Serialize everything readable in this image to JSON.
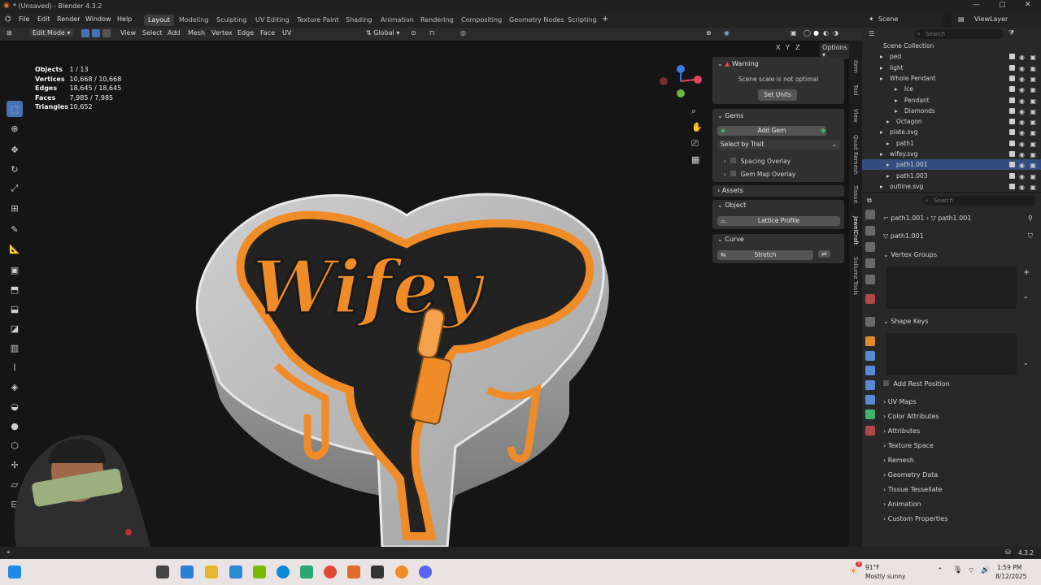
{
  "window": {
    "title": "* (Unsaved) - Blender 4.3.2",
    "version": "4.3.2"
  },
  "menu": {
    "items": [
      "File",
      "Edit",
      "Render",
      "Window",
      "Help"
    ]
  },
  "workspaces": [
    "Layout",
    "Modeling",
    "Sculpting",
    "UV Editing",
    "Texture Paint",
    "Shading",
    "Animation",
    "Rendering",
    "Compositing",
    "Geometry Nodes",
    "Scripting"
  ],
  "active_workspace": "Layout",
  "scene": {
    "name": "Scene",
    "view_layer": "ViewLayer"
  },
  "viewport_header": {
    "mode": "Edit Mode",
    "menus": [
      "View",
      "Select",
      "Add",
      "Mesh",
      "Vertex",
      "Edge",
      "Face",
      "UV"
    ],
    "transform": "Global",
    "options": "Options",
    "axes": [
      "X",
      "Y",
      "Z"
    ]
  },
  "stats": [
    {
      "label": "Objects",
      "value": "1 / 13"
    },
    {
      "label": "Vertices",
      "value": "10,668 / 10,668"
    },
    {
      "label": "Edges",
      "value": "18,645 / 18,645"
    },
    {
      "label": "Faces",
      "value": "7,985 / 7,985"
    },
    {
      "label": "Triangles",
      "value": "10,652"
    }
  ],
  "npanel": {
    "warning_title": "Warning",
    "warning_text": "Scene scale is not optimal",
    "set_units": "Set Units",
    "gems_title": "Gems",
    "add_gem": "Add Gem",
    "select_by_trait": "Select by Trait",
    "spacing_overlay": "Spacing Overlay",
    "gem_map_overlay": "Gem Map Overlay",
    "assets": "Assets",
    "object_title": "Object",
    "lattice_profile": "Lattice Profile",
    "curve_title": "Curve",
    "stretch": "Stretch",
    "tabs": [
      "Item",
      "Tool",
      "View",
      "Quad Remesh",
      "Tissue",
      "JewelCraft",
      "Sollumz Tools"
    ]
  },
  "outliner": {
    "search_placeholder": "Search",
    "rows": [
      "Scene Collection",
      "ped",
      "light",
      "Whole Pendant",
      "Ice",
      "Pendant",
      "Diamonds",
      "Octagon",
      "plate.svg",
      "path1",
      "wifey.svg",
      "path1.001",
      "path1.003",
      "outline.svg",
      "path1.002"
    ]
  },
  "properties": {
    "search_placeholder": "Search",
    "breadcrumb_obj": "path1.001",
    "breadcrumb_data": "path1.001",
    "data_name": "path1.001",
    "vertex_groups": "Vertex Groups",
    "shape_keys": "Shape Keys",
    "add_rest_position": "Add Rest Position",
    "sections": [
      "UV Maps",
      "Color Attributes",
      "Attributes",
      "Texture Space",
      "Remesh",
      "Geometry Data",
      "Tissue Tessellate",
      "Animation",
      "Custom Properties"
    ]
  },
  "taskbar": {
    "weather_temp": "91°F",
    "weather_desc": "Mostly sunny",
    "time": "1:59 PM",
    "date": "8/12/2025",
    "badge": "3"
  },
  "colors": {
    "accent": "#4772b3",
    "selection": "#334d80",
    "orange": "#f08c28",
    "warning": "#e14d42"
  }
}
